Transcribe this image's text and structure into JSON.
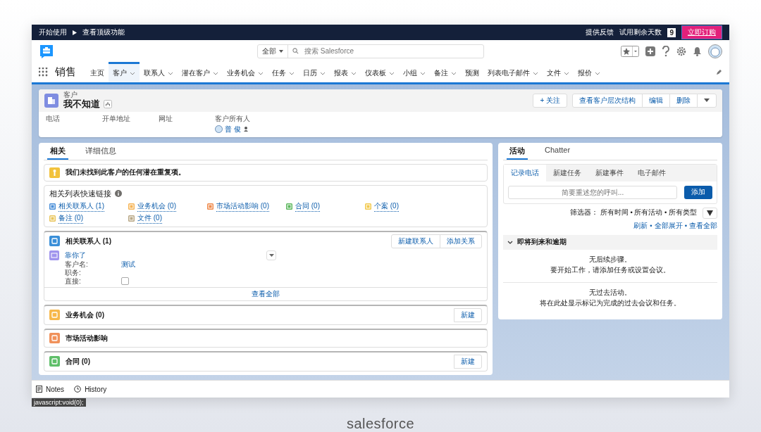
{
  "top_bar": {
    "breadcrumb": [
      "开始使用",
      "查看顶级功能"
    ],
    "feedback": "提供反馈",
    "trial_label": "试用剩余天数",
    "trial_days": "9",
    "buy_button": "立即订购"
  },
  "header": {
    "search_scope": "全部",
    "search_placeholder": "搜索 Salesforce"
  },
  "nav": {
    "app_name": "销售",
    "items": [
      {
        "label": "主页",
        "dropdown": false,
        "selected": false
      },
      {
        "label": "客户",
        "dropdown": true,
        "selected": true
      },
      {
        "label": "联系人",
        "dropdown": true,
        "selected": false
      },
      {
        "label": "潜在客户",
        "dropdown": true,
        "selected": false
      },
      {
        "label": "业务机会",
        "dropdown": true,
        "selected": false
      },
      {
        "label": "任务",
        "dropdown": true,
        "selected": false
      },
      {
        "label": "日历",
        "dropdown": true,
        "selected": false
      },
      {
        "label": "报表",
        "dropdown": true,
        "selected": false
      },
      {
        "label": "仪表板",
        "dropdown": true,
        "selected": false
      },
      {
        "label": "小组",
        "dropdown": true,
        "selected": false
      },
      {
        "label": "备注",
        "dropdown": true,
        "selected": false
      },
      {
        "label": "预测",
        "dropdown": false,
        "selected": false
      },
      {
        "label": "列表电子邮件",
        "dropdown": true,
        "selected": false
      },
      {
        "label": "文件",
        "dropdown": true,
        "selected": false
      },
      {
        "label": "报价",
        "dropdown": true,
        "selected": false
      }
    ]
  },
  "record": {
    "object_type": "客户",
    "name": "我不知道",
    "actions": [
      "+ 关注",
      "查看客户层次结构",
      "编辑",
      "删除"
    ],
    "fields": [
      {
        "label": "电话"
      },
      {
        "label": "开单地址"
      },
      {
        "label": "网址"
      },
      {
        "label": "客户所有人",
        "value": "普 俊"
      }
    ]
  },
  "left_tabs": [
    {
      "label": "相关",
      "selected": true
    },
    {
      "label": "详细信息",
      "selected": false
    }
  ],
  "duplicate_alert": "我们未找到此客户的任何潜在重复项。",
  "quick_links": {
    "title": "相关列表快速链接",
    "links": [
      {
        "label": "相关联系人 (1)",
        "color": "#4a8fd8"
      },
      {
        "label": "业务机会 (0)",
        "color": "#f6b455"
      },
      {
        "label": "市场活动影响 (0)",
        "color": "#ef8a4c"
      },
      {
        "label": "合同 (0)",
        "color": "#5db85e"
      },
      {
        "label": "个案 (0)",
        "color": "#f2c94c"
      },
      {
        "label": "备注 (0)",
        "color": "#e9c55b"
      },
      {
        "label": "文件 (0)",
        "color": "#b9a887"
      }
    ]
  },
  "related_lists": [
    {
      "title": "相关联系人 (1)",
      "color": "#3a8fd8",
      "buttons": [
        "新建联系人",
        "添加关系"
      ],
      "records": [
        {
          "name": "靠你了",
          "fields": [
            {
              "kind": "link",
              "label": "客户名:",
              "value": "测试"
            },
            {
              "kind": "text",
              "label": "职务:"
            },
            {
              "kind": "checkbox",
              "label": "直接:",
              "checked": false
            }
          ]
        }
      ],
      "footer": "查看全部"
    },
    {
      "title": "业务机会 (0)",
      "color": "#f7b84b",
      "buttons": [
        "新建"
      ]
    },
    {
      "title": "市场活动影响",
      "color": "#f0915a"
    },
    {
      "title": "合同 (0)",
      "color": "#5fbf6a",
      "buttons": [
        "新建"
      ]
    }
  ],
  "activity": {
    "tabs": [
      {
        "label": "活动",
        "selected": true
      },
      {
        "label": "Chatter",
        "selected": false
      }
    ],
    "subtabs": [
      {
        "label": "记录电话",
        "selected": true
      },
      {
        "label": "新建任务",
        "selected": false
      },
      {
        "label": "新建事件",
        "selected": false
      },
      {
        "label": "电子邮件",
        "selected": false
      }
    ],
    "placeholder": "简要重述您的呼叫...",
    "add_button": "添加",
    "filter": "筛选器：  所有时间 • 所有活动 • 所有类型",
    "links": [
      "刷新",
      "全部展开",
      "查看全部"
    ],
    "link_separator": "•",
    "section": {
      "title": "即将到来和逾期",
      "expanded": true
    },
    "empty_upcoming": [
      "无后续步骤。",
      "要开始工作，请添加任务或设置会议。"
    ],
    "empty_past": [
      "无过去活动。",
      "将在此处显示标记为完成的过去会议和任务。"
    ]
  },
  "utility_bar": [
    "Notes",
    "History"
  ],
  "status_tooltip": "javascript:void(0);",
  "caption": "salesforce"
}
